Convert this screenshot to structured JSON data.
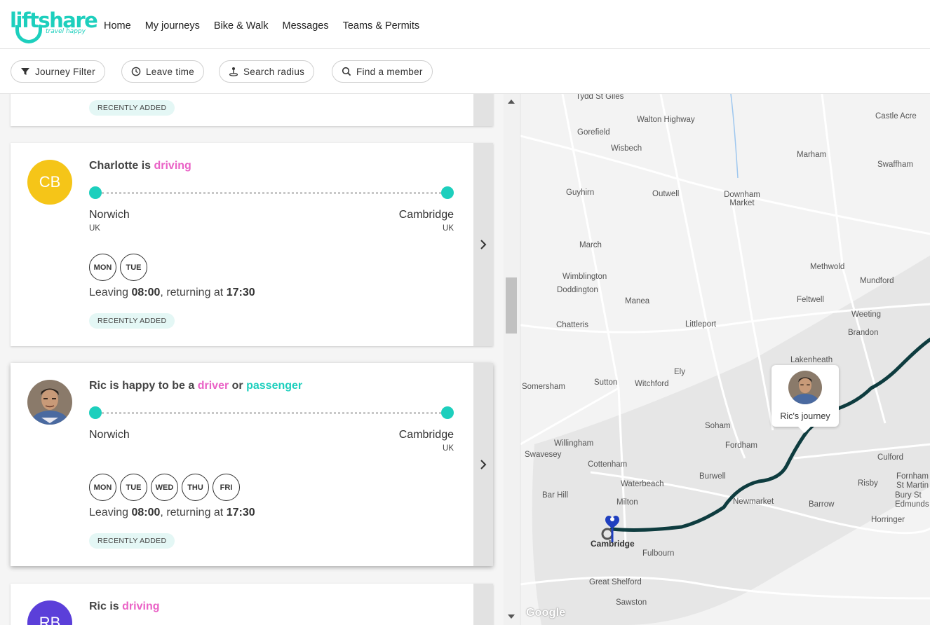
{
  "brand": {
    "name": "liftshare",
    "tagline": "travel happy",
    "color": "#1dcfbd"
  },
  "nav": [
    "Home",
    "My journeys",
    "Bike & Walk",
    "Messages",
    "Teams & Permits"
  ],
  "filters": [
    {
      "label": "Journey Filter",
      "icon": "filter-icon"
    },
    {
      "label": "Leave time",
      "icon": "clock-icon"
    },
    {
      "label": "Search radius",
      "icon": "radius-icon"
    },
    {
      "label": "Find a member",
      "icon": "search-icon"
    }
  ],
  "cards": [
    {
      "badge": "RECENTLY ADDED"
    },
    {
      "initials": "CB",
      "avatar_color": "#f5c518",
      "name": "Charlotte",
      "is": "is",
      "role": "driving",
      "from": "Norwich",
      "from_country": "UK",
      "to": "Cambridge",
      "to_country": "UK",
      "days": [
        "MON",
        "TUE"
      ],
      "leaving_prefix": "Leaving",
      "leave_time": "08:00",
      "returning_prefix": ", returning at",
      "return_time": "17:30",
      "badge": "RECENTLY ADDED"
    },
    {
      "name": "Ric",
      "title_prefix": "Ric is happy to be a",
      "role1": "driver",
      "or": "or",
      "role2": "passenger",
      "from": "Norwich",
      "from_country": "",
      "to": "Cambridge",
      "to_country": "UK",
      "days": [
        "MON",
        "TUE",
        "WED",
        "THU",
        "FRI"
      ],
      "leaving_prefix": "Leaving",
      "leave_time": "08:00",
      "returning_prefix": ", returning at",
      "return_time": "17:30",
      "badge": "RECENTLY ADDED"
    },
    {
      "initials": "RB",
      "avatar_color": "#5b3fd9",
      "name": "Ric",
      "is": "is",
      "role": "driving"
    }
  ],
  "map": {
    "popup_label": "Ric's journey",
    "attribution": "Google",
    "places": [
      "Tydd St Giles",
      "Walton Highway",
      "Gorefield",
      "Wisbech",
      "Castle Acre",
      "Marham",
      "Swaffham",
      "Guyhirn",
      "Outwell",
      "Downham Market",
      "March",
      "Methwold",
      "Mundford",
      "Wimblington",
      "Doddington",
      "Manea",
      "Feltwell",
      "Weeting",
      "Chatteris",
      "Littleport",
      "Brandon",
      "Lakenheath",
      "Ely",
      "Somersham",
      "Sutton",
      "Witchford",
      "Soham",
      "Willingham",
      "Swavesey",
      "Fordham",
      "Culford",
      "Cottenham",
      "Waterbeach",
      "Burwell",
      "Risby",
      "Fornham St Martin",
      "Bury St Edmunds",
      "Bar Hill",
      "Milton",
      "Newmarket",
      "Barrow",
      "Horringer",
      "Cambridge",
      "Fulbourn",
      "Great Shelford",
      "Sawston"
    ]
  }
}
